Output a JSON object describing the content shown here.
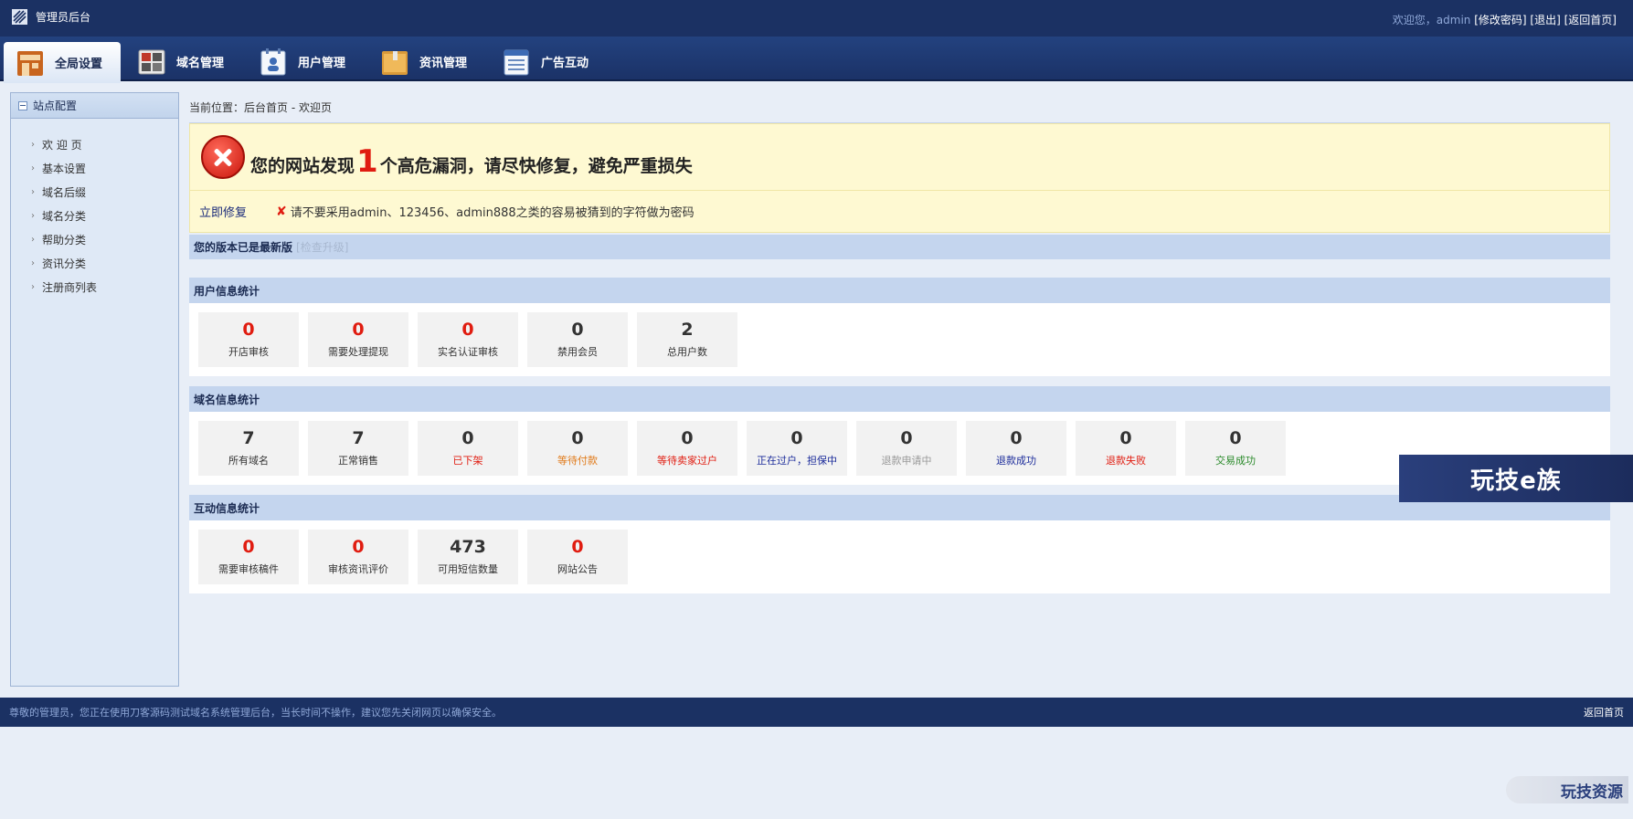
{
  "topbar": {
    "title": "管理员后台",
    "greeting": "欢迎您，admin",
    "change_password": "[修改密码]",
    "logout": "[退出]",
    "back_home": "[返回首页]"
  },
  "nav": {
    "tabs": [
      {
        "label": "全局设置",
        "icon": "building-icon"
      },
      {
        "label": "域名管理",
        "icon": "grid-icon"
      },
      {
        "label": "用户管理",
        "icon": "user-card-icon"
      },
      {
        "label": "资讯管理",
        "icon": "folder-icon"
      },
      {
        "label": "广告互动",
        "icon": "list-icon"
      }
    ]
  },
  "sidebar": {
    "title": "站点配置",
    "items": [
      "欢 迎 页",
      "基本设置",
      "域名后缀",
      "域名分类",
      "帮助分类",
      "资讯分类",
      "注册商列表"
    ]
  },
  "breadcrumb": "当前位置：后台首页 - 欢迎页",
  "alert": {
    "prefix": "您的网站发现",
    "count": "1",
    "suffix": "个高危漏洞，请尽快修复，避免严重损失",
    "fix_link": "立即修复",
    "tip": "请不要采用admin、123456、admin888之类的容易被猜到的字符做为密码"
  },
  "version": {
    "text": "您的版本已是最新版",
    "check": "[检查升级]"
  },
  "colors": {
    "red": "#e01c10",
    "dark": "#333333",
    "orange": "#e07a1a",
    "navy": "#1b2b9a",
    "gray": "#999999",
    "green": "#2a8a2a"
  },
  "user_stats": {
    "title": "用户信息统计",
    "cards": [
      {
        "value": "0",
        "label": "开店审核",
        "num_color": "red",
        "label_color": "dark"
      },
      {
        "value": "0",
        "label": "需要处理提现",
        "num_color": "red",
        "label_color": "dark"
      },
      {
        "value": "0",
        "label": "实名认证审核",
        "num_color": "red",
        "label_color": "dark"
      },
      {
        "value": "0",
        "label": "禁用会员",
        "num_color": "dark",
        "label_color": "dark"
      },
      {
        "value": "2",
        "label": "总用户数",
        "num_color": "dark",
        "label_color": "dark"
      }
    ]
  },
  "domain_stats": {
    "title": "域名信息统计",
    "cards": [
      {
        "value": "7",
        "label": "所有域名",
        "num_color": "dark",
        "label_color": "dark"
      },
      {
        "value": "7",
        "label": "正常销售",
        "num_color": "dark",
        "label_color": "dark"
      },
      {
        "value": "0",
        "label": "已下架",
        "num_color": "dark",
        "label_color": "red"
      },
      {
        "value": "0",
        "label": "等待付款",
        "num_color": "dark",
        "label_color": "orange"
      },
      {
        "value": "0",
        "label": "等待卖家过户",
        "num_color": "dark",
        "label_color": "red"
      },
      {
        "value": "0",
        "label": "正在过户，担保中",
        "num_color": "dark",
        "label_color": "navy"
      },
      {
        "value": "0",
        "label": "退款申请中",
        "num_color": "dark",
        "label_color": "gray"
      },
      {
        "value": "0",
        "label": "退款成功",
        "num_color": "dark",
        "label_color": "navy"
      },
      {
        "value": "0",
        "label": "退款失败",
        "num_color": "dark",
        "label_color": "red"
      },
      {
        "value": "0",
        "label": "交易成功",
        "num_color": "dark",
        "label_color": "green"
      }
    ]
  },
  "interact_stats": {
    "title": "互动信息统计",
    "cards": [
      {
        "value": "0",
        "label": "需要审核稿件",
        "num_color": "red",
        "label_color": "dark"
      },
      {
        "value": "0",
        "label": "审核资讯评价",
        "num_color": "red",
        "label_color": "dark"
      },
      {
        "value": "473",
        "label": "可用短信数量",
        "num_color": "dark",
        "label_color": "dark"
      },
      {
        "value": "0",
        "label": "网站公告",
        "num_color": "red",
        "label_color": "dark"
      }
    ]
  },
  "footer": {
    "note": "尊敬的管理员，您正在使用刀客源码测试域名系统管理后台，当长时间不操作，建议您先关闭网页以确保安全。",
    "back": "返回首页"
  },
  "watermarks": {
    "right": "玩技e族",
    "bottom": "玩技资源"
  }
}
